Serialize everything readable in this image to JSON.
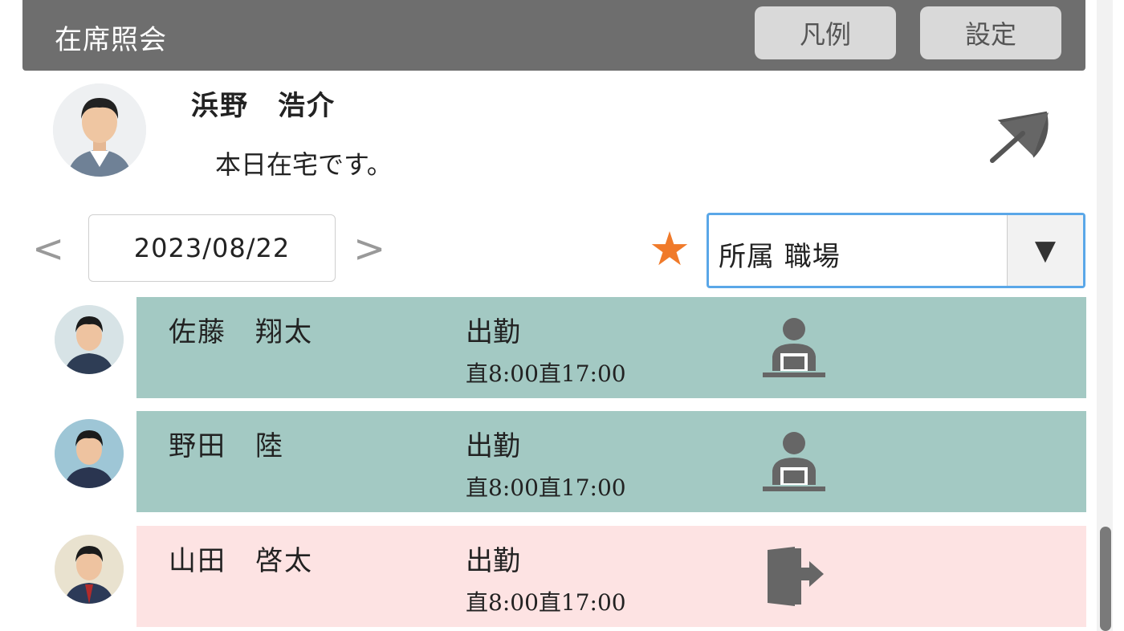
{
  "header": {
    "title": "在席照会",
    "legend_button": "凡例",
    "settings_button": "設定"
  },
  "me": {
    "name": "浜野　浩介",
    "message": "本日在宅です。",
    "status_icon": "umbrella-icon"
  },
  "date_nav": {
    "prev": "<",
    "date": "2023/08/22",
    "next": ">"
  },
  "filter": {
    "favorite_icon": "star-icon",
    "selected": "所属 職場",
    "dropdown_glyph": "▼"
  },
  "colors": {
    "header_bg": "#6e6e6e",
    "present_row": "#a3c9c3",
    "out_row": "#fde3e3",
    "star": "#f07a2a",
    "focus_border": "#5aa7e8"
  },
  "members": [
    {
      "name": "佐藤　翔太",
      "status": "出勤",
      "time": "直8:00直17:00",
      "icon": "desk-worker-icon",
      "state": "present"
    },
    {
      "name": "野田　陸",
      "status": "出勤",
      "time": "直8:00直17:00",
      "icon": "desk-worker-icon",
      "state": "present"
    },
    {
      "name": "山田　啓太",
      "status": "出勤",
      "time": "直8:00直17:00",
      "icon": "exit-door-icon",
      "state": "out"
    }
  ]
}
